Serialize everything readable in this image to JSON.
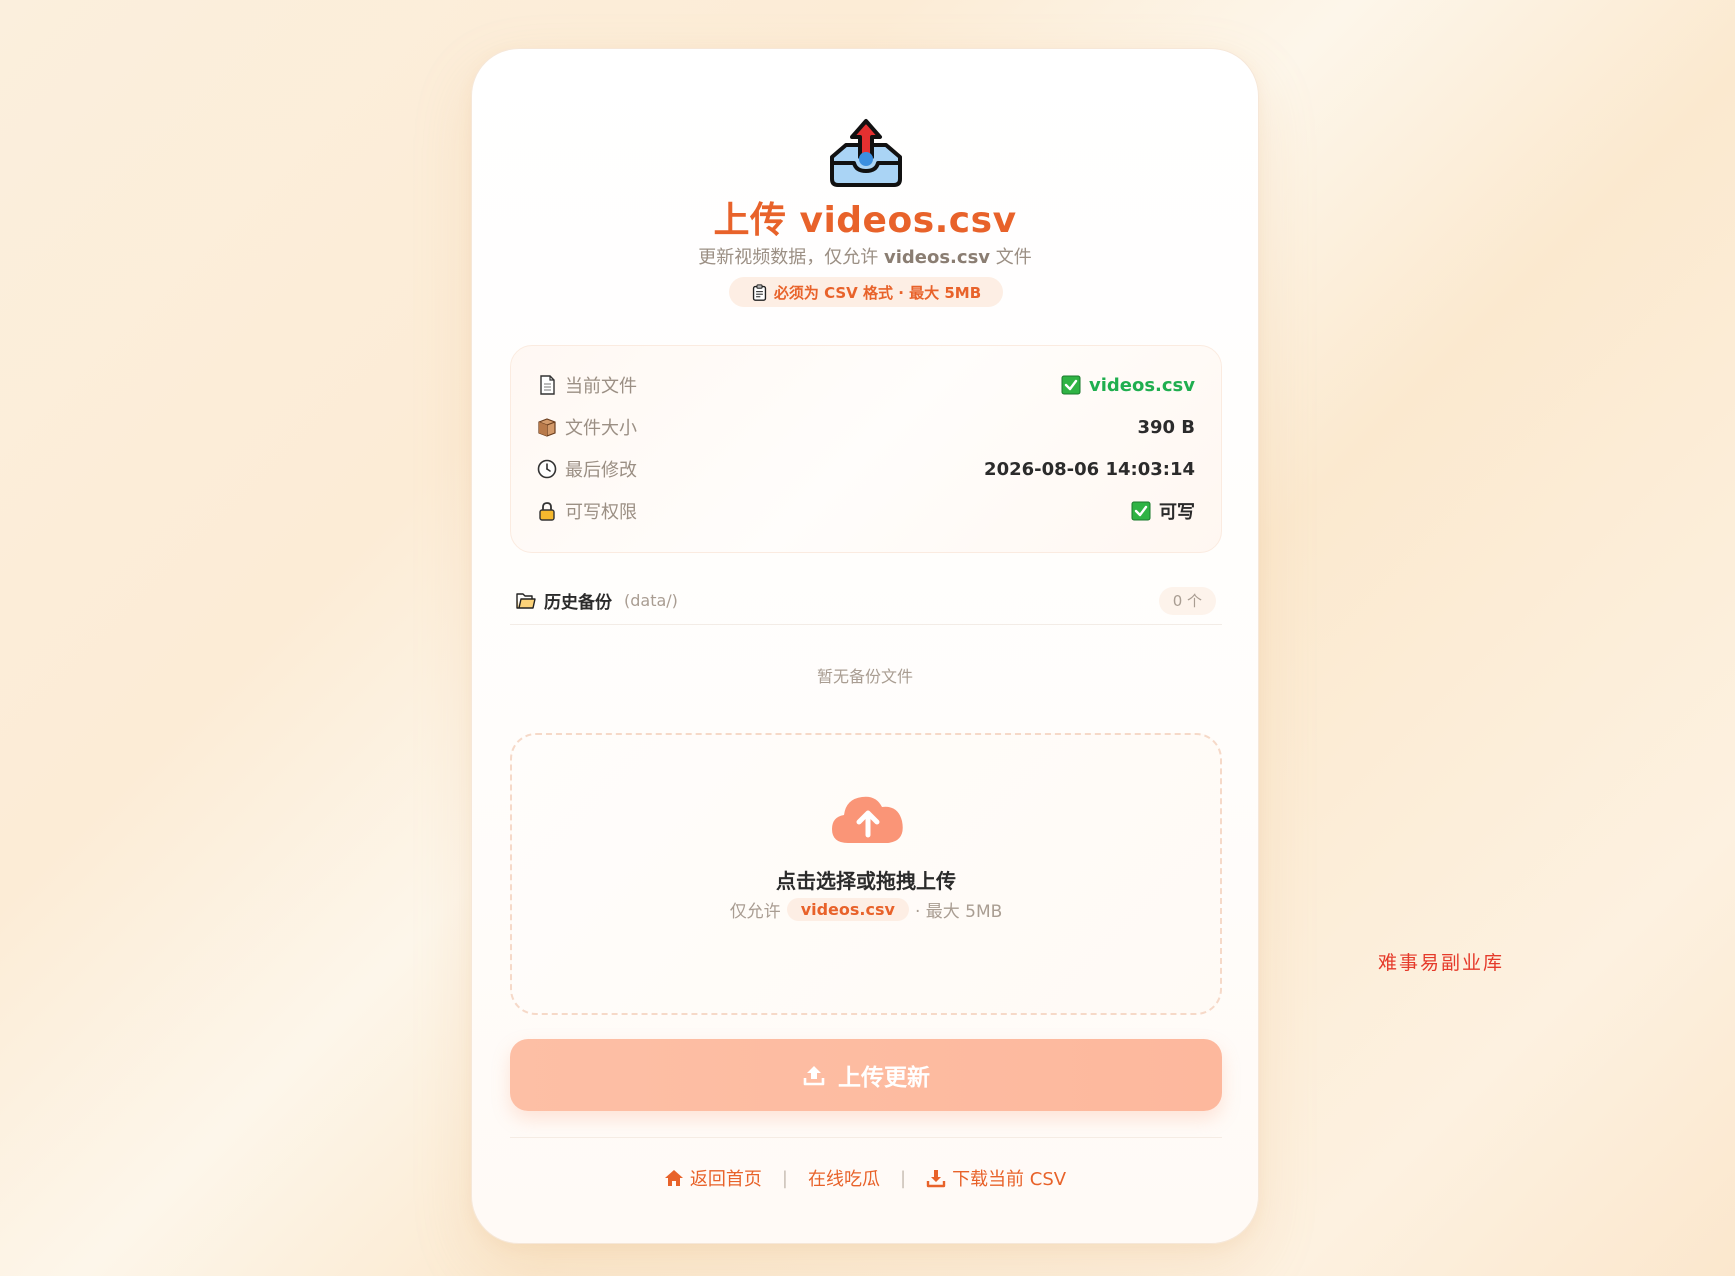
{
  "header": {
    "icon": "outbox-tray-icon",
    "title": "上传 videos.csv",
    "subtitle_prefix": "更新视频数据，仅允许 ",
    "subtitle_filename": "videos.csv",
    "subtitle_suffix": " 文件",
    "format_note": "必须为 CSV 格式 · 最大 5MB"
  },
  "file_info": {
    "rows": [
      {
        "icon": "page-icon",
        "label": "当前文件",
        "value": "videos.csv",
        "status_icon": "check-mark-icon"
      },
      {
        "icon": "box-icon",
        "label": "文件大小",
        "value": "390 B"
      },
      {
        "icon": "clock-icon",
        "label": "最后修改",
        "value": "2026-08-06 14:03:14"
      },
      {
        "icon": "lock-icon",
        "label": "可写权限",
        "value": "可写",
        "status_icon": "check-mark-icon"
      }
    ]
  },
  "backups": {
    "title": "历史备份",
    "path": "(data/)",
    "count": "0 个",
    "empty_text": "暂无备份文件"
  },
  "dropzone": {
    "title": "点击选择或拖拽上传",
    "hint_prefix": "仅允许",
    "hint_file": "videos.csv",
    "hint_suffix": "· 最大 5MB"
  },
  "upload_button": {
    "label": "上传更新"
  },
  "footer": {
    "home": "返回首页",
    "gossip": "在线吃瓜",
    "download": "下载当前 CSV",
    "separator": "|"
  },
  "watermark": "难事易副业库",
  "colors": {
    "accent": "#e8622a",
    "success": "#1fae4f",
    "button": "#fdbfa5",
    "text": "#2b2b2b",
    "muted": "#9b8f84"
  }
}
